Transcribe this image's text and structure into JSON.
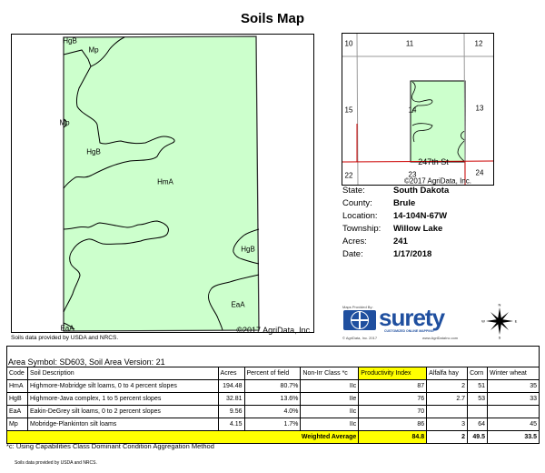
{
  "title": "Soils Map",
  "main_map": {
    "labels": [
      {
        "t": "HgB"
      },
      {
        "t": "Mp"
      },
      {
        "t": "Mp"
      },
      {
        "t": "HgB"
      },
      {
        "t": "HmA"
      },
      {
        "t": "HgB"
      },
      {
        "t": "EaA"
      },
      {
        "t": "EaA"
      }
    ],
    "copyright": "©2017 AgriData, Inc.",
    "fill_color": "#ccffcc",
    "source": "Soils data provided by USDA and NRCS."
  },
  "inset_map": {
    "sections": [
      "10",
      "11",
      "12",
      "15",
      "14",
      "13",
      "22",
      "23",
      "24"
    ],
    "road": "247th St",
    "copyright": "©2017 AgriData, Inc."
  },
  "info": [
    {
      "k": "State:",
      "v": "South Dakota"
    },
    {
      "k": "County:",
      "v": "Brule"
    },
    {
      "k": "Location:",
      "v": "14-104N-67W"
    },
    {
      "k": "Township:",
      "v": "Willow Lake"
    },
    {
      "k": "Acres:",
      "v": "241"
    },
    {
      "k": "Date:",
      "v": "1/17/2018"
    }
  ],
  "logo": {
    "provided": "Maps Provided By:",
    "brand": "surety",
    "tagline": "CUSTOMIZED ONLINE MAPPING",
    "left": "© AgriData, Inc. 2017",
    "right": "www.AgriDataInc.com"
  },
  "compass": {
    "n": "N",
    "s": "S",
    "e": "E",
    "w": "W"
  },
  "table": {
    "area": "Area Symbol: SD603, Soil Area Version: 21",
    "headers": [
      "Code",
      "Soil Description",
      "Acres",
      "Percent of field",
      "Non-Irr Class *c",
      "Productivity Index",
      "Alfalfa hay",
      "Corn",
      "Winter wheat"
    ],
    "rows": [
      [
        "HmA",
        "Highmore-Mobridge silt loams, 0 to 4 percent slopes",
        "194.48",
        "80.7%",
        "IIc",
        "87",
        "2",
        "51",
        "35"
      ],
      [
        "HgB",
        "Highmore-Java complex, 1 to 5 percent slopes",
        "32.81",
        "13.6%",
        "IIe",
        "76",
        "2.7",
        "53",
        "33"
      ],
      [
        "EaA",
        "Eakin-DeGrey silt loams, 0 to 2 percent slopes",
        "9.56",
        "4.0%",
        "IIc",
        "70",
        "",
        "",
        ""
      ],
      [
        "Mp",
        "Mobridge-Plankinton silt loams",
        "4.15",
        "1.7%",
        "IIc",
        "86",
        "3",
        "64",
        "45"
      ]
    ],
    "weighted": {
      "label": "Weighted Average",
      "pi": "84.8",
      "alfalfa": "2",
      "corn": "49.5",
      "wheat": "33.5"
    }
  },
  "footnote": "*c: Using Capabilities Class Dominant Condition Aggregation Method",
  "footer_source": "Soils data provided by USDA and NRCS."
}
